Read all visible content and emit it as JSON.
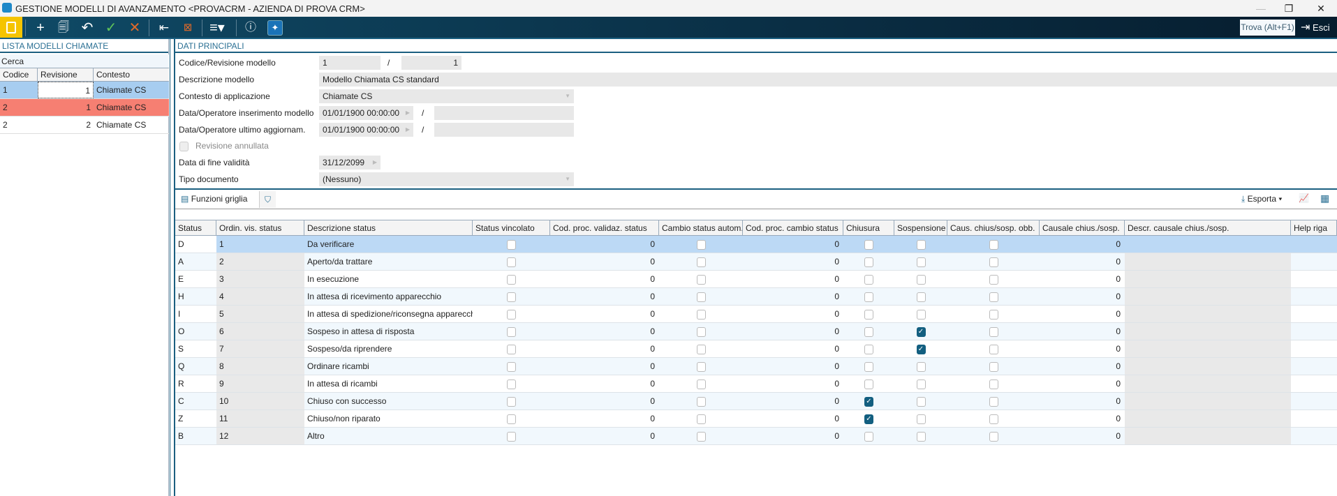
{
  "window": {
    "title": "GESTIONE MODELLI DI AVANZAMENTO <PROVACRM - AZIENDA DI PROVA CRM>"
  },
  "toolbar": {
    "find_label": "Trova (Alt+F1)",
    "exit_label": "Esci"
  },
  "left_panel": {
    "title": "LISTA MODELLI CHIAMATE",
    "search_label": "Cerca",
    "columns": [
      "Codice",
      "Revisione",
      "Contesto"
    ],
    "rows": [
      [
        "1",
        "1",
        "Chiamate CS"
      ],
      [
        "2",
        "1",
        "Chiamate CS"
      ],
      [
        "2",
        "2",
        "Chiamate CS"
      ]
    ]
  },
  "form": {
    "title": "DATI PRINCIPALI",
    "codice_label": "Codice/Revisione modello",
    "codice": "1",
    "revisione": "1",
    "descrizione_label": "Descrizione modello",
    "descrizione": "Modello Chiamata CS standard",
    "contesto_label": "Contesto di applicazione",
    "contesto": "Chiamate CS",
    "ins_label": "Data/Operatore inserimento modello",
    "ins_date": "01/01/1900 00:00:00",
    "upd_label": "Data/Operatore ultimo aggiornam.",
    "upd_date": "01/01/1900 00:00:00",
    "annullata_label": "Revisione annullata",
    "fine_label": "Data di fine validità",
    "fine": "31/12/2099",
    "tipo_label": "Tipo documento",
    "tipo": "(Nessuno)",
    "slash": "/"
  },
  "grid_toolbar": {
    "functions_label": "Funzioni griglia",
    "export_label": "Esporta"
  },
  "grid": {
    "columns": [
      "Status",
      "Ordin. vis. status",
      "Descrizione status",
      "Status vincolato",
      "Cod. proc. validaz. status",
      "Cambio status autom.",
      "Cod. proc. cambio status",
      "Chiusura",
      "Sospensione",
      "Caus. chius/sosp. obb.",
      "Causale chius./sosp.",
      "Descr. causale chius./sosp.",
      "Help riga"
    ],
    "rows": [
      {
        "status": "D",
        "ord": "1",
        "descr": "Da verificare",
        "chiusura": false,
        "sosp": false
      },
      {
        "status": "A",
        "ord": "2",
        "descr": "Aperto/da trattare",
        "chiusura": false,
        "sosp": false
      },
      {
        "status": "E",
        "ord": "3",
        "descr": "In esecuzione",
        "chiusura": false,
        "sosp": false
      },
      {
        "status": "H",
        "ord": "4",
        "descr": "In attesa di ricevimento apparecchio",
        "chiusura": false,
        "sosp": false
      },
      {
        "status": "I",
        "ord": "5",
        "descr": "In attesa di spedizione/riconsegna apparecchio",
        "chiusura": false,
        "sosp": false
      },
      {
        "status": "O",
        "ord": "6",
        "descr": "Sospeso in attesa di risposta",
        "chiusura": false,
        "sosp": true
      },
      {
        "status": "S",
        "ord": "7",
        "descr": "Sospeso/da riprendere",
        "chiusura": false,
        "sosp": true
      },
      {
        "status": "Q",
        "ord": "8",
        "descr": "Ordinare ricambi",
        "chiusura": false,
        "sosp": false
      },
      {
        "status": "R",
        "ord": "9",
        "descr": "In attesa di ricambi",
        "chiusura": false,
        "sosp": false
      },
      {
        "status": "C",
        "ord": "10",
        "descr": "Chiuso con successo",
        "chiusura": true,
        "sosp": false
      },
      {
        "status": "Z",
        "ord": "11",
        "descr": "Chiuso/non riparato",
        "chiusura": true,
        "sosp": false
      },
      {
        "status": "B",
        "ord": "12",
        "descr": "Altro",
        "chiusura": false,
        "sosp": false
      }
    ],
    "zero": "0"
  },
  "colors": {
    "accent": "#135f80",
    "selected": "#a7cdf0",
    "error_row": "#f67f72"
  }
}
